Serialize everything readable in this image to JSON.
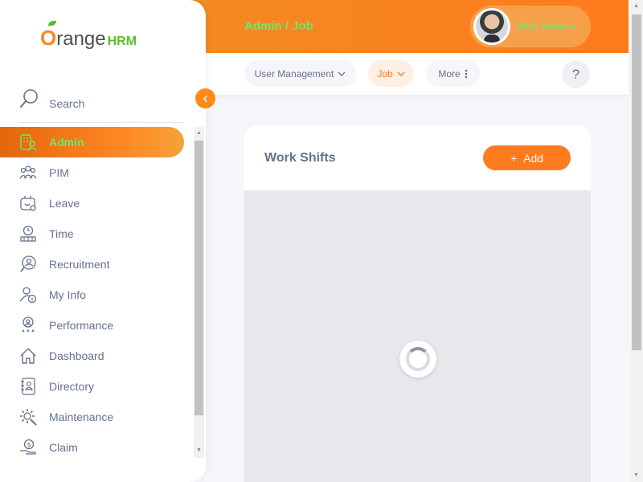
{
  "header": {
    "breadcrumb": "Admin / Job",
    "user_name": "Bob Tester",
    "user_chevron": "⌄"
  },
  "subnav": {
    "items": [
      {
        "label": "User Management",
        "icon": "chevron-down-icon",
        "active": false
      },
      {
        "label": "Job",
        "icon": "chevron-down-icon",
        "active": true
      },
      {
        "label": "More",
        "icon": "more-vertical-icon",
        "active": false
      }
    ],
    "help_label": "?"
  },
  "card": {
    "title": "Work Shifts",
    "add_label": "Add",
    "add_icon": "+"
  },
  "sidebar": {
    "logo_main": "range",
    "logo_prefix": "O",
    "logo_suffix": "HRM",
    "search_label": "Search",
    "items": [
      {
        "label": "Admin",
        "icon": "admin-icon",
        "active": true
      },
      {
        "label": "PIM",
        "icon": "pim-icon"
      },
      {
        "label": "Leave",
        "icon": "leave-icon"
      },
      {
        "label": "Time",
        "icon": "time-icon"
      },
      {
        "label": "Recruitment",
        "icon": "recruitment-icon"
      },
      {
        "label": "My Info",
        "icon": "my-info-icon"
      },
      {
        "label": "Performance",
        "icon": "performance-icon"
      },
      {
        "label": "Dashboard",
        "icon": "dashboard-icon"
      },
      {
        "label": "Directory",
        "icon": "directory-icon"
      },
      {
        "label": "Maintenance",
        "icon": "maintenance-icon"
      },
      {
        "label": "Claim",
        "icon": "claim-icon"
      }
    ]
  },
  "colors": {
    "brand_orange": "#ff7b1d",
    "active_green_text": "#6fe86d",
    "text_gray": "#64728c"
  }
}
